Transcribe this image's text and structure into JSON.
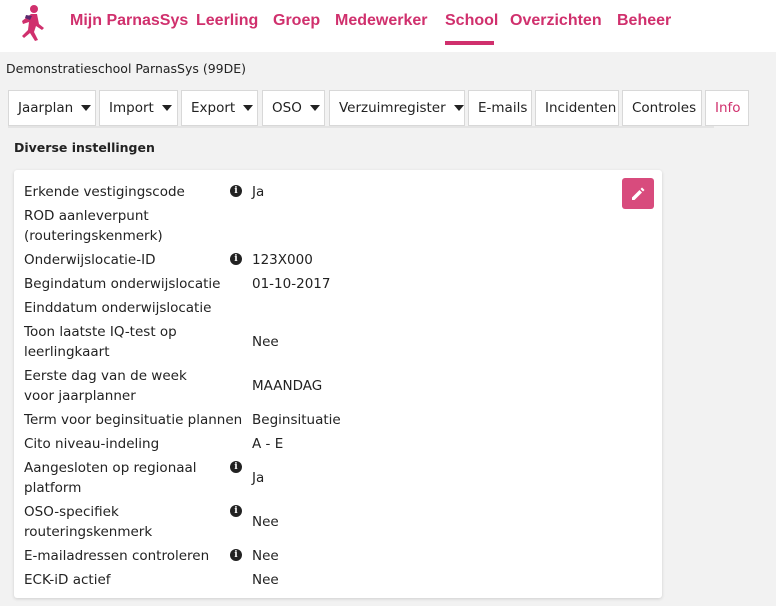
{
  "nav": {
    "items": [
      "Mijn ParnasSys",
      "Leerling",
      "Groep",
      "Medewerker",
      "School",
      "Overzichten",
      "Beheer"
    ],
    "active": "School"
  },
  "org_title": "Demonstratieschool ParnasSys (99DE)",
  "tabs": [
    {
      "label": "Jaarplan",
      "dropdown": true
    },
    {
      "label": "Import",
      "dropdown": true
    },
    {
      "label": "Export",
      "dropdown": true
    },
    {
      "label": "OSO",
      "dropdown": true
    },
    {
      "label": "Verzuimregister",
      "dropdown": true
    },
    {
      "label": "E-mails",
      "dropdown": false
    },
    {
      "label": "Incidenten",
      "dropdown": false
    },
    {
      "label": "Controles",
      "dropdown": false
    },
    {
      "label": "Info",
      "dropdown": false,
      "active": true
    }
  ],
  "section_title": "Diverse instellingen",
  "settings": [
    {
      "label": "Erkende vestigingscode",
      "value": "Ja",
      "info": true
    },
    {
      "label": "ROD aanleverpunt (routeringskenmerk)",
      "value": "",
      "info": false
    },
    {
      "label": "Onderwijslocatie-ID",
      "value": "123X000",
      "info": true
    },
    {
      "label": "Begindatum onderwijslocatie",
      "value": "01-10-2017",
      "info": false
    },
    {
      "label": "Einddatum onderwijslocatie",
      "value": "",
      "info": false
    },
    {
      "label": "Toon laatste IQ-test op leerlingkaart",
      "value": "Nee",
      "info": false
    },
    {
      "label": "Eerste dag van de week voor jaarplanner",
      "value": "MAANDAG",
      "info": false
    },
    {
      "label": "Term voor beginsituatie plannen",
      "value": "Beginsituatie",
      "info": false
    },
    {
      "label": "Cito niveau-indeling",
      "value": "A - E",
      "info": false
    },
    {
      "label": "Aangesloten op regionaal platform",
      "value": "Ja",
      "info": true
    },
    {
      "label": "OSO-specifiek routeringskenmerk",
      "value": "Nee",
      "info": true
    },
    {
      "label": "E-mailadressen controleren",
      "value": "Nee",
      "info": true
    },
    {
      "label": "ECK-iD actief",
      "value": "Nee",
      "info": false
    }
  ],
  "icons": {
    "edit": "pencil-icon",
    "info": "info-icon",
    "logo": "running-figure-logo"
  },
  "colors": {
    "accent": "#d0306d",
    "edit_button": "#d84b7d"
  }
}
